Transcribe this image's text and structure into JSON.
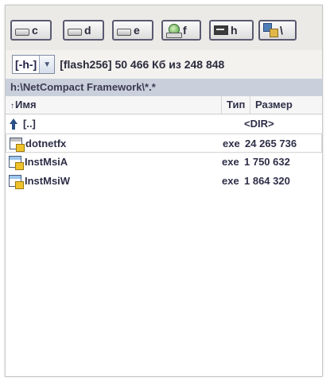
{
  "drives": [
    {
      "letter": "c",
      "kind": "disk"
    },
    {
      "letter": "d",
      "kind": "disk"
    },
    {
      "letter": "e",
      "kind": "disk"
    },
    {
      "letter": "f",
      "kind": "network"
    },
    {
      "letter": "h",
      "kind": "flash"
    },
    {
      "letter": "\\",
      "kind": "root"
    }
  ],
  "path_bar": {
    "combo_value": "[-h-]",
    "free_space_text": "[flash256]  50 466 Кб из 248 848"
  },
  "current_path": "h:\\NetCompact Framework\\*.*",
  "columns": {
    "name": "Имя",
    "type": "Тип",
    "size": "Размер"
  },
  "files": [
    {
      "name": "[..]",
      "type": "",
      "size": "<DIR>",
      "icon": "up-dir-icon"
    },
    {
      "name": "dotnetfx",
      "type": "exe",
      "size": "24 265 736",
      "icon": "exe-icon"
    },
    {
      "name": "InstMsiA",
      "type": "exe",
      "size": "1 750 632",
      "icon": "exe-icon"
    },
    {
      "name": "InstMsiW",
      "type": "exe",
      "size": "1 864 320",
      "icon": "exe-icon"
    }
  ],
  "colors": {
    "drivebar_bg": "#eceae6",
    "path_bg": "#c9d0dc",
    "text": "#2e2e48"
  }
}
